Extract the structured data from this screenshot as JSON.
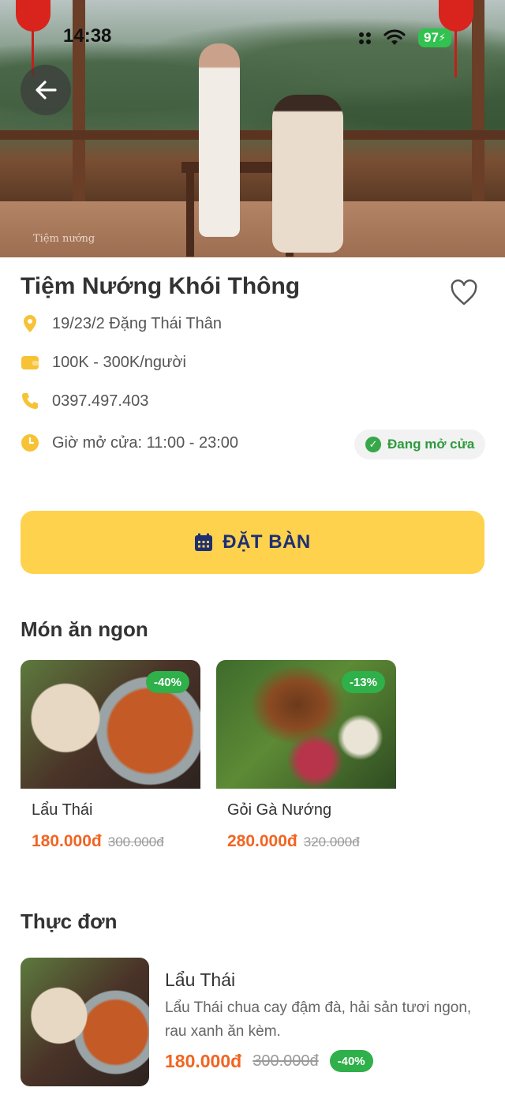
{
  "status": {
    "time": "14:38",
    "battery": "97"
  },
  "hero": {
    "watermark": "Tiệm nướng"
  },
  "restaurant": {
    "name": "Tiệm Nướng Khói Thông",
    "address": "19/23/2 Đặng Thái Thân",
    "price_range": "100K - 300K/người",
    "phone": "0397.497.403",
    "hours": "Giờ mở cửa: 11:00 - 23:00",
    "open_status": "Đang mở cửa"
  },
  "booking": {
    "button_label": "ĐẶT BÀN"
  },
  "featured": {
    "title": "Món ăn ngon",
    "items": [
      {
        "name": "Lẩu Thái",
        "price": "180.000đ",
        "old_price": "300.000đ",
        "discount": "-40%"
      },
      {
        "name": "Gỏi Gà Nướng",
        "price": "280.000đ",
        "old_price": "320.000đ",
        "discount": "-13%"
      }
    ]
  },
  "menu": {
    "title": "Thực đơn",
    "items": [
      {
        "name": "Lẩu Thái",
        "description": "Lẩu Thái chua cay đậm đà, hải sản tươi ngon, rau xanh ăn kèm.",
        "price": "180.000đ",
        "old_price": "300.000đ",
        "discount": "-40%"
      }
    ]
  },
  "colors": {
    "accent": "#ffd24d",
    "price": "#f26422",
    "discount": "#2fb04a",
    "open": "#36a84a",
    "icon": "#f7c236"
  },
  "icons": [
    "back-arrow-icon",
    "heart-icon",
    "location-pin-icon",
    "wallet-icon",
    "phone-icon",
    "clock-icon",
    "check-circle-icon",
    "calendar-icon"
  ]
}
